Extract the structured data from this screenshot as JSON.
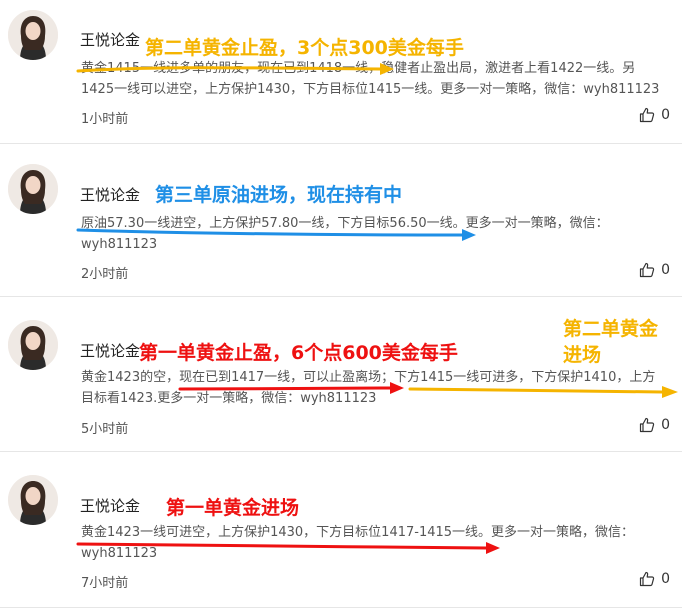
{
  "colors": {
    "gold": "#f5b400",
    "blue": "#1f8fe6",
    "red": "#ee1111",
    "text": "#555555",
    "divider": "#e6e6e6"
  },
  "posts": [
    {
      "author": "王悦论金",
      "annotation": "第二单黄金止盈，3个点300美金每手",
      "line1": "黄金1415一线进多单的朋友，现在已到1418一线，稳健者止盈出局，激进者上看1422一线。另",
      "line2": "1425一线可以进空，上方保护1430，下方目标位1415一线。更多一对一策略，微信：wyh811123",
      "time": "1小时前",
      "likes": "0"
    },
    {
      "author": "王悦论金",
      "annotation": "第三单原油进场，现在持有中",
      "line1": "原油57.30一线进空，上方保护57.80一线，下方目标56.50一线。更多一对一策略，微信：",
      "line2": "wyh811123",
      "time": "2小时前",
      "likes": "0"
    },
    {
      "author": "王悦论金",
      "annotation": "第一单黄金止盈，6个点600美金每手",
      "annotation2": "第二单黄金进场",
      "line1": "黄金1423的空，现在已到1417一线，可以止盈离场；下方1415一线可进多，下方保护1410，上方",
      "line2": "目标看1423.更多一对一策略，微信：wyh811123",
      "time": "5小时前",
      "likes": "0"
    },
    {
      "author": "王悦论金",
      "annotation": "第一单黄金进场",
      "line1": "黄金1423一线可进空，上方保护1430，下方目标位1417-1415一线。更多一对一策略，微信：",
      "line2": "wyh811123",
      "time": "7小时前",
      "likes": "0"
    }
  ]
}
